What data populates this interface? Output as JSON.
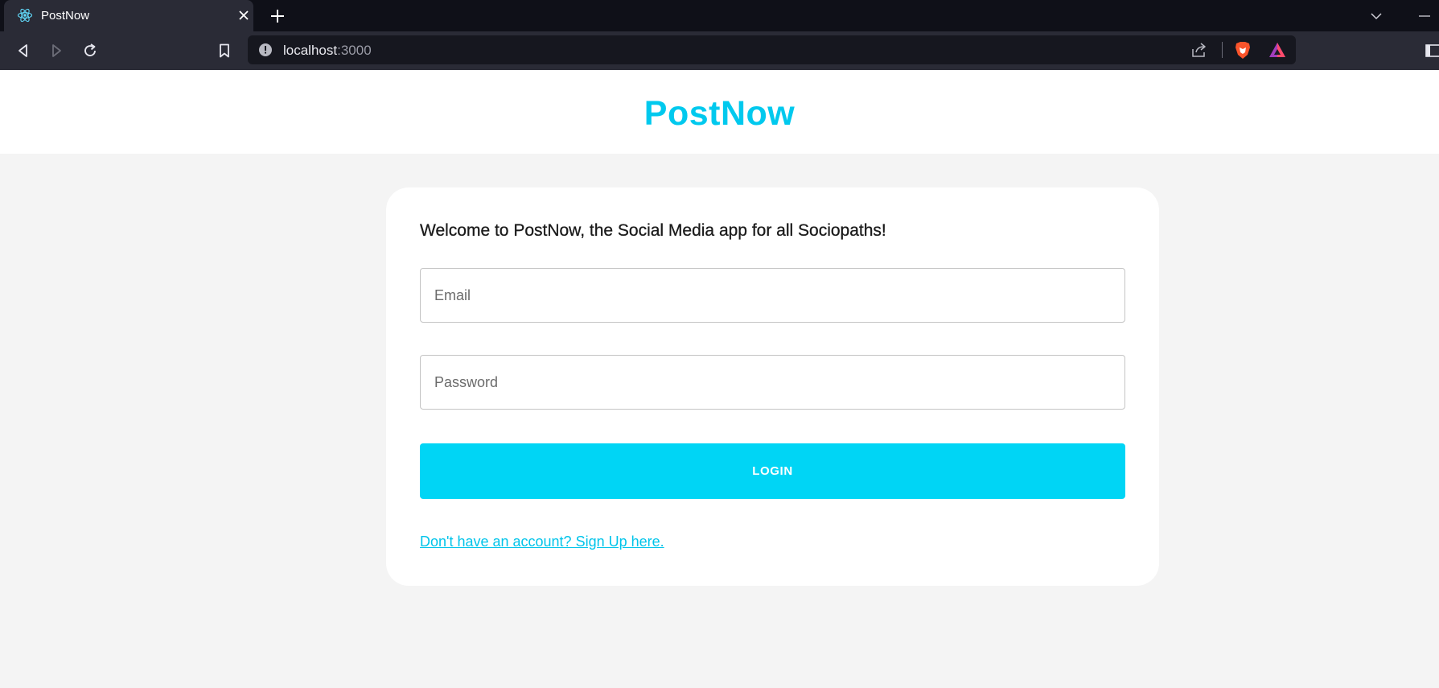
{
  "browser": {
    "tab_title": "PostNow",
    "url_host": "localhost",
    "url_port": ":3000"
  },
  "header": {
    "brand": "PostNow"
  },
  "login": {
    "welcome_text": "Welcome to PostNow, the Social Media app for all Sociopaths!",
    "email_placeholder": "Email",
    "email_value": "",
    "password_placeholder": "Password",
    "password_value": "",
    "login_label": "LOGIN",
    "signup_link": "Don't have an account? Sign Up here."
  },
  "colors": {
    "brand": "#00c9ee",
    "button": "#00d5f5",
    "link": "#00c4ea",
    "page_bg": "#f4f4f4"
  },
  "icons": {
    "favicon": "react-icon",
    "tab_close": "close-icon",
    "new_tab": "plus-icon",
    "back": "back-icon",
    "forward": "forward-icon",
    "reload": "reload-icon",
    "bookmark": "bookmark-icon",
    "site_info": "info-icon",
    "share": "share-icon",
    "brave_shields": "brave-lion-icon",
    "brave_rewards": "brave-rewards-icon"
  }
}
